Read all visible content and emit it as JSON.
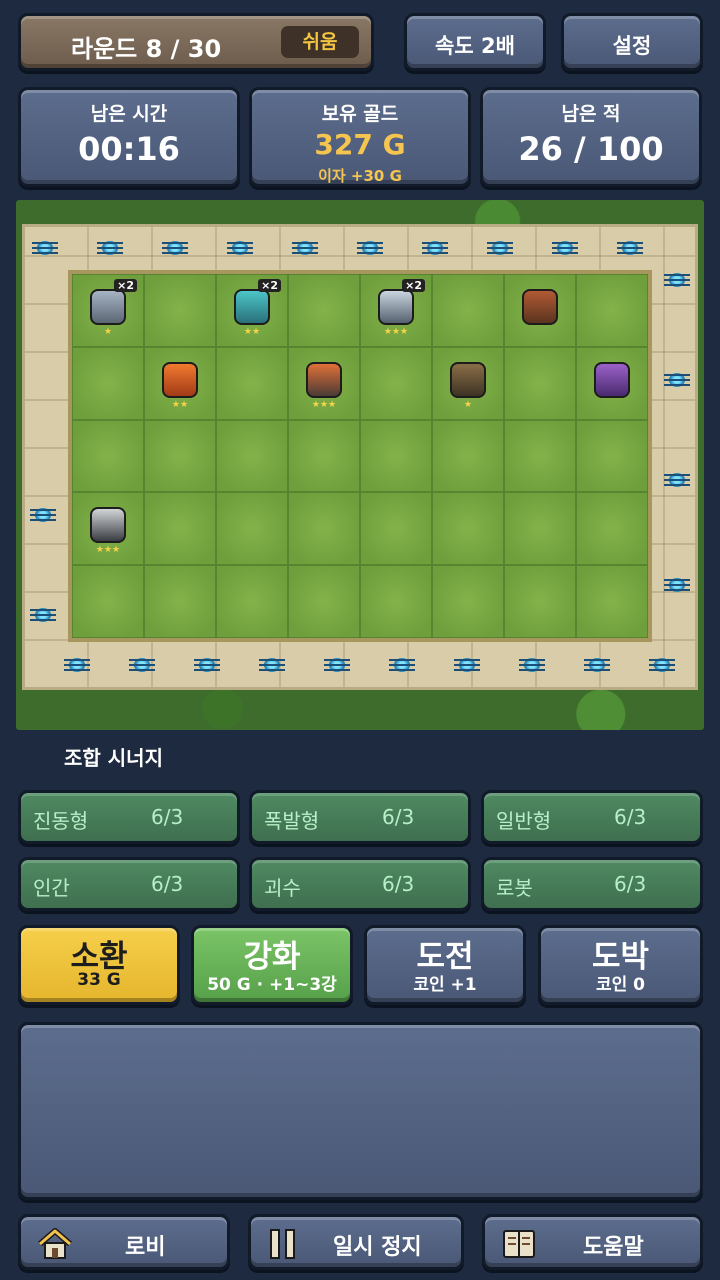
{
  "top_bar": {
    "round_label": "라운드 8 / 30",
    "difficulty": "쉬움",
    "speed_label": "속도 2배",
    "settings_label": "설정"
  },
  "stats": {
    "time_label": "남은 시간",
    "time_value": "00:16",
    "gold_label": "보유 골드",
    "gold_value": "327 G",
    "gold_interest": "이자 +30 G",
    "enemy_label": "남은 적",
    "enemy_value": "26 / 100"
  },
  "board": {
    "units": [
      {
        "name": "unit-mech-squad",
        "row": 0,
        "col": 0,
        "stars": "★",
        "count": "×2",
        "type": "u-mech"
      },
      {
        "name": "unit-cyan-beast",
        "row": 0,
        "col": 2,
        "stars": "★★",
        "count": "×2",
        "type": "u-beast"
      },
      {
        "name": "unit-spider-bot",
        "row": 0,
        "col": 4,
        "stars": "★★★",
        "count": "×2",
        "type": "u-spider"
      },
      {
        "name": "unit-heavy-gunner",
        "row": 0,
        "col": 6,
        "stars": "",
        "count": "",
        "type": "u-gunner"
      },
      {
        "name": "unit-fire-lizard",
        "row": 1,
        "col": 1,
        "stars": "★★",
        "count": "",
        "type": "u-lizard"
      },
      {
        "name": "unit-battle-robot",
        "row": 1,
        "col": 3,
        "stars": "★★★",
        "count": "",
        "type": "u-robot"
      },
      {
        "name": "unit-sniper",
        "row": 1,
        "col": 5,
        "stars": "★",
        "count": "",
        "type": "u-sniper"
      },
      {
        "name": "unit-purple-dragon",
        "row": 1,
        "col": 7,
        "stars": "",
        "count": "",
        "type": "u-dragon"
      },
      {
        "name": "unit-tank-walker",
        "row": 3,
        "col": 0,
        "stars": "★★★",
        "count": "",
        "type": "u-tank"
      }
    ]
  },
  "synergy": {
    "title": "조합 시너지",
    "items": [
      {
        "name": "진동형",
        "value": "6/3"
      },
      {
        "name": "폭발형",
        "value": "6/3"
      },
      {
        "name": "일반형",
        "value": "6/3"
      },
      {
        "name": "인간",
        "value": "6/3"
      },
      {
        "name": "괴수",
        "value": "6/3"
      },
      {
        "name": "로봇",
        "value": "6/3"
      }
    ]
  },
  "actions": {
    "summon": {
      "label": "소환",
      "sub": "33 G"
    },
    "upgrade": {
      "label": "강화",
      "sub": "50 G · +1~3강"
    },
    "challenge": {
      "label": "도전",
      "sub": "코인 +1"
    },
    "gamble": {
      "label": "도박",
      "sub": "코인 0"
    }
  },
  "bottom_nav": {
    "lobby": "로비",
    "pause": "일시 정지",
    "help": "도움말"
  },
  "colors": {
    "background": "#1e2a3f",
    "gold": "#f6c550",
    "summon": "#f6cf4a",
    "upgrade": "#7bc467",
    "synergy": "#4f8a62"
  },
  "icons": {
    "lobby": "home-icon",
    "pause": "pause-icon",
    "help": "book-icon"
  }
}
